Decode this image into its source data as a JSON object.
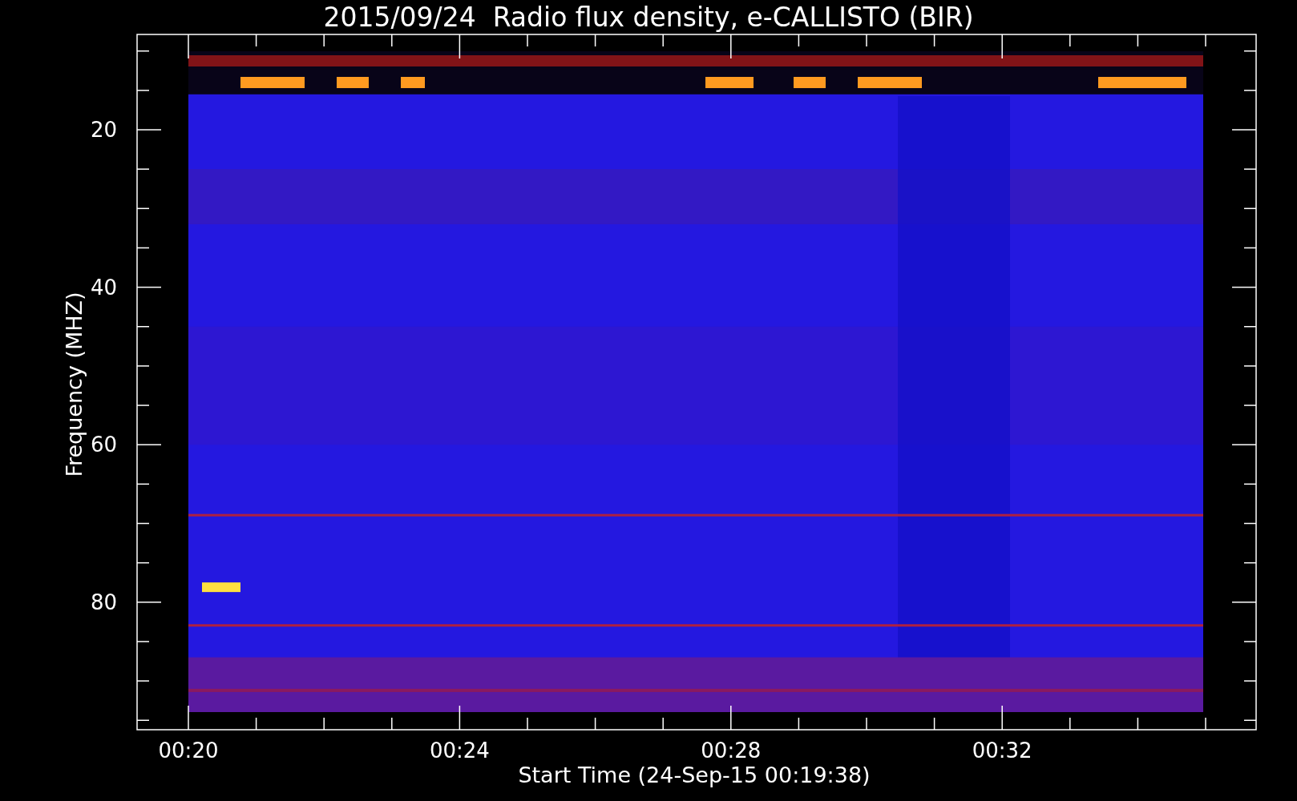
{
  "title": "2015/09/24  Radio flux density, e-CALLISTO (BIR)",
  "y_axis": {
    "label": "Frequency (MHZ)",
    "ticks": [
      "20",
      "40",
      "60",
      "80"
    ]
  },
  "x_axis": {
    "label": "Start Time (24-Sep-15 00:19:38)",
    "ticks": [
      "00:20",
      "00:24",
      "00:28",
      "00:32"
    ]
  }
}
